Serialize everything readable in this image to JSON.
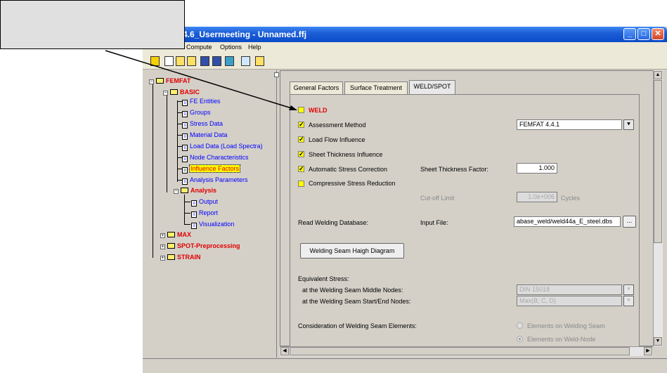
{
  "window": {
    "title": "4.6_Usermeeting - Unnamed.ffj",
    "controls": [
      "minimize",
      "maximize",
      "close"
    ]
  },
  "menu": [
    "Compute",
    "Options",
    "Help"
  ],
  "toolbar_icons": [
    "compute-icon",
    "new-file-icon",
    "open-folder-icon",
    "open-folder-star-icon",
    "save-icon",
    "save-as-icon",
    "network-icon",
    "report-icon",
    "exit-icon"
  ],
  "tree": {
    "root": "FEMFAT",
    "basic": "BASIC",
    "items": {
      "fe_entities": "FE Entities",
      "groups": "Groups",
      "stress_data": "Stress Data",
      "material_data": "Material Data",
      "load_data": "Load Data (Load Spectra)",
      "node_characteristics": "Node Characteristics",
      "influence_factors": "Influence Factors",
      "analysis_parameters": "Analysis Parameters"
    },
    "analysis": "Analysis",
    "analysis_items": {
      "output": "Output",
      "report": "Report",
      "visualization": "Visualization"
    },
    "max": "MAX",
    "spot": "SPOT-Preprocessing",
    "strain": "STRAIN"
  },
  "tabs": {
    "general": "General Factors",
    "surface": "Surface Treatment",
    "weld": "WELD/SPOT"
  },
  "weld": {
    "title": "WELD",
    "assessment_method": "Assessment Method",
    "assessment_value": "FEMFAT 4.4.1",
    "load_flow": "Load Flow Influence",
    "sheet_thickness": "Sheet Thickness Influence",
    "auto_stress": "Automatic Stress Correction",
    "sheet_factor_label": "Sheet Thickness Factor:",
    "sheet_factor_value": "1.000",
    "compressive": "Compressive Stress Reduction",
    "cutoff_label": "Cut-off Limit",
    "cutoff_value": "1.0e+006",
    "cycles": "Cycles",
    "read_db": "Read Welding Database:",
    "input_file_label": "Input File:",
    "input_file_value": "abase_weld/weld44a_E_steel.dbs",
    "browse": "...",
    "haigh_button": "Welding Seam Haigh Diagram",
    "equivalent_stress": "Equivalent Stress:",
    "middle_nodes": "at the Welding Seam Middle Nodes:",
    "middle_value": "DIN 15018",
    "start_end_nodes": "at the Welding Seam Start/End Nodes:",
    "start_end_value": "Max(B, C, D)",
    "consideration": "Consideration of Welding Seam Elements:",
    "radio_seam": "Elements on Welding Seam",
    "radio_node": "Elements on Weld-Node"
  },
  "colors": {
    "tree_item": "#0000ff",
    "tree_category": "#e00000",
    "checkbox": "#ffff00",
    "titlebar": "#0a4bc8"
  }
}
